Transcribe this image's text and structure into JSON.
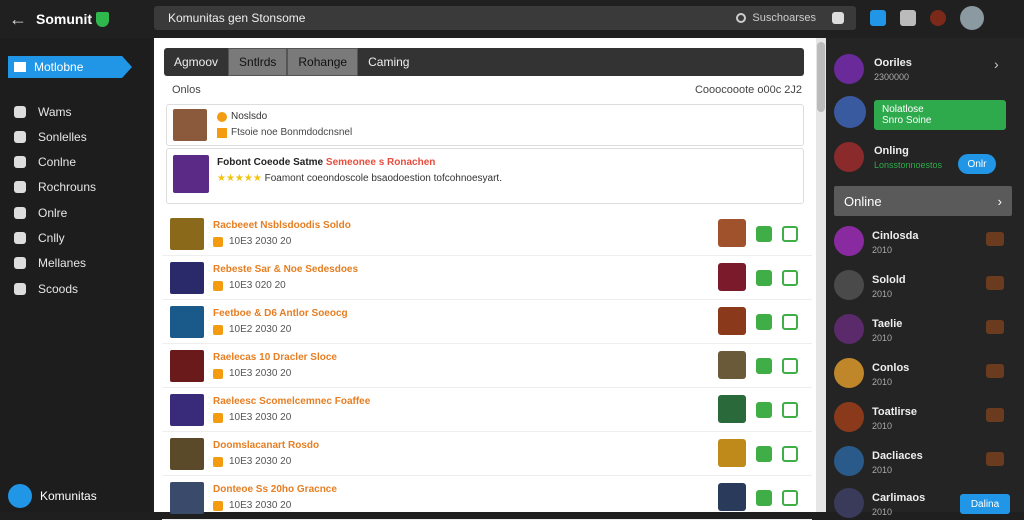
{
  "app": {
    "name": "Somunit"
  },
  "search": {
    "placeholder": "Komunitas gen Stonsome",
    "right_label": "Suschoarses"
  },
  "sidebar": {
    "active": "Motlobne",
    "items": [
      "Wams",
      "Sonlelles",
      "Conlne",
      "Rochrouns",
      "Onlre",
      "Cnlly",
      "Mellanes",
      "Scoods"
    ],
    "bottom": "Komunitas"
  },
  "main": {
    "tabs": [
      "Agmoov",
      "Sntlrds",
      "Rohange",
      "Caming"
    ],
    "panel_title": "Onlos",
    "panel_meta": "Cooocooote o00c 2J2",
    "card1": {
      "title": "Noslsdo",
      "sub": "Ftsoie noe Bonmdodcnsnel"
    },
    "card2": {
      "title": "Fobont Coeode Satme",
      "title2": "Semeonee s Ronachen",
      "text": "Foamont coeondoscole bsaodoestion tofcohnoesyart.",
      "stars": "★★★★★"
    },
    "rows": [
      {
        "title": "Racbeeet Nsblsdoodis Soldo",
        "meta": "10E3 2030 20"
      },
      {
        "title": "Rebeste Sar & Noe Sedesdoes",
        "meta": "10E3 020 20"
      },
      {
        "title": "Feetboe & D6 Antlor Soeocg",
        "meta": "10E2 2030 20"
      },
      {
        "title": "Raelecas 10 Dracler Sloce",
        "meta": "10E3 2030 20"
      },
      {
        "title": "Raeleesc Scomelcemnec Foaffee",
        "meta": "10E3 2030 20"
      },
      {
        "title": "Doomslacanart Rosdo",
        "meta": "10E3 2030 20"
      },
      {
        "title": "Donteoe Ss 20ho Gracnce",
        "meta": "10E3 2030 20"
      }
    ]
  },
  "right": {
    "top": {
      "name": "Ooriles",
      "sub": "2300000"
    },
    "green": {
      "name": "Nolatlose",
      "sub": "Snro Soine"
    },
    "online_user": {
      "name": "Onling",
      "sub": "Lonsstonnoestos"
    },
    "blue_btn": "Onlr",
    "section": "Online",
    "friends": [
      {
        "name": "Cinlosda",
        "sub": "2010"
      },
      {
        "name": "Solold",
        "sub": "2010"
      },
      {
        "name": "Taelie",
        "sub": "2010"
      },
      {
        "name": "Conlos",
        "sub": "2010"
      },
      {
        "name": "Toatlirse",
        "sub": "2010"
      },
      {
        "name": "Dacliaces",
        "sub": "2010"
      },
      {
        "name": "Carlimaos",
        "sub": "2010"
      }
    ],
    "bottom_btn": "Dalina"
  }
}
